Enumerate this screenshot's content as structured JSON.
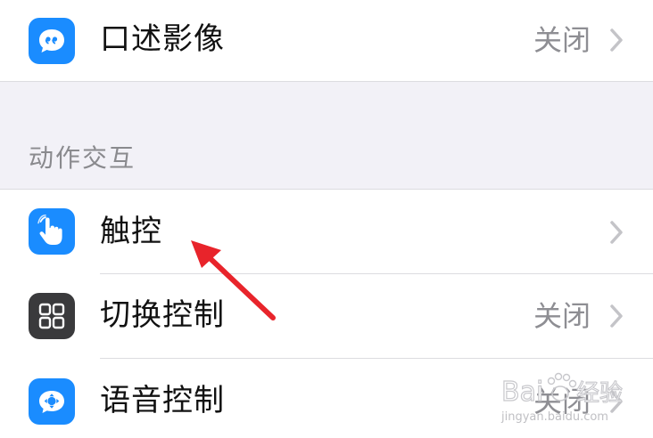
{
  "top_group": {
    "items": [
      {
        "label": "口述影像",
        "value": "关闭",
        "icon": "speech-bubble-icon"
      }
    ]
  },
  "section": {
    "header": "动作交互"
  },
  "interaction_group": {
    "items": [
      {
        "label": "触控",
        "value": "",
        "icon": "touch-hand-icon"
      },
      {
        "label": "切换控制",
        "value": "关闭",
        "icon": "switch-grid-icon"
      },
      {
        "label": "语音控制",
        "value": "关闭",
        "icon": "voice-control-icon"
      }
    ]
  },
  "annotation": {
    "arrow_color": "#e8242b",
    "target": "触控"
  },
  "watermark": {
    "text_main": "Bai",
    "text_sub": "经验",
    "url": "jingyan.baidu.com"
  },
  "colors": {
    "accent_blue": "#1a8cff",
    "dark_tile": "#3a3a3c",
    "background": "#f2f1f7"
  }
}
